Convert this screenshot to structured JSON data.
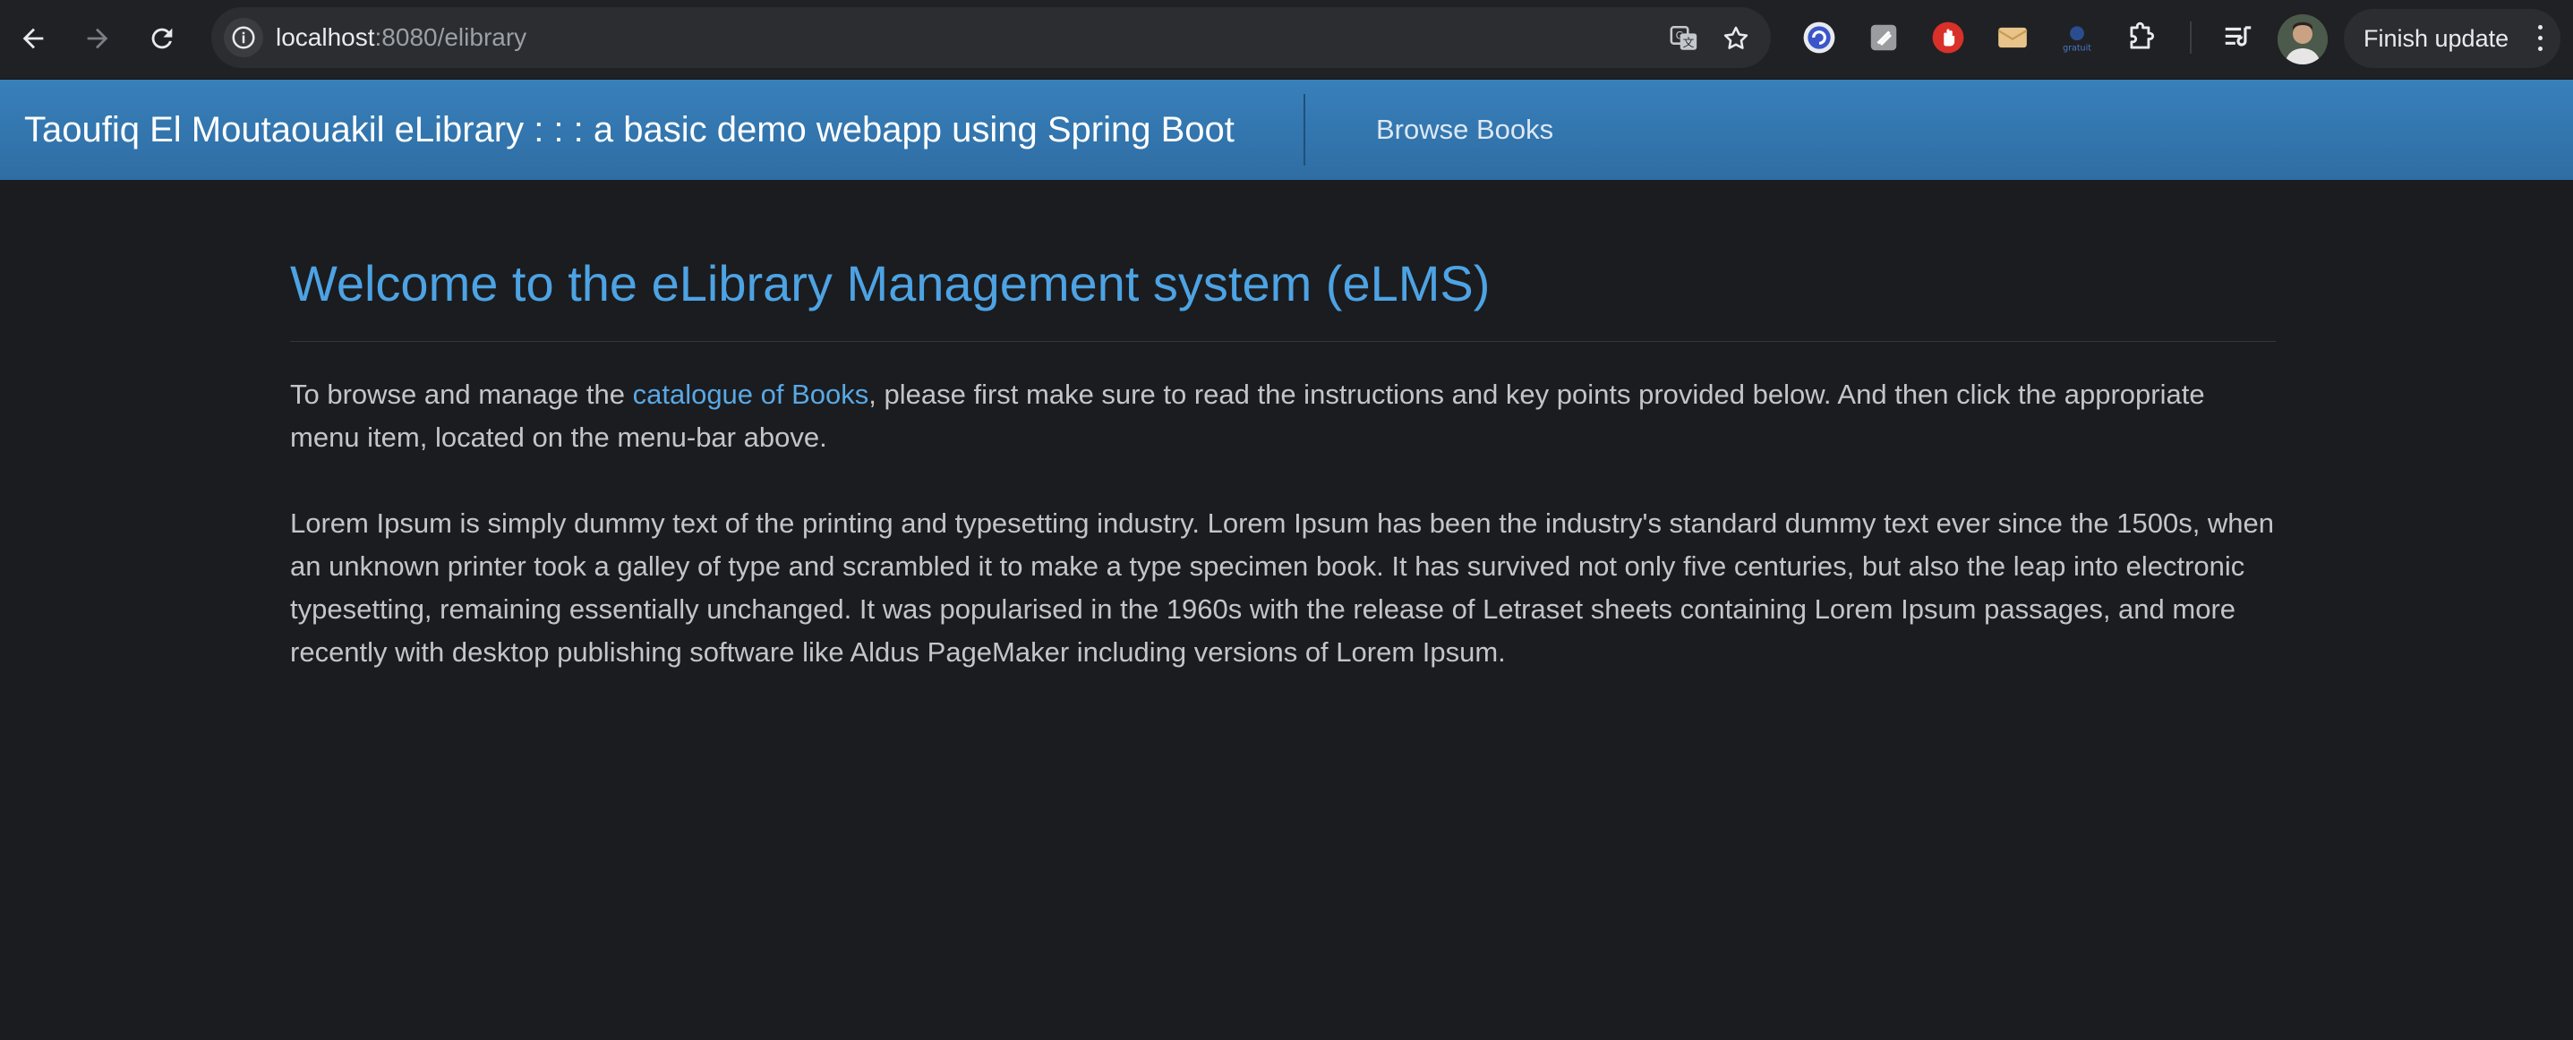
{
  "browser": {
    "url_host": "localhost",
    "url_path": ":8080/elibrary",
    "finish_update_label": "Finish update",
    "icons": [
      "back-arrow-icon",
      "forward-arrow-icon",
      "reload-icon",
      "site-info-icon",
      "translate-icon",
      "bookmark-star-icon",
      "extensions-puzzle-icon",
      "reading-list-icon",
      "more-vert-icon"
    ]
  },
  "navbar": {
    "brand": "Taoufiq El Moutaouakil eLibrary : : : a basic demo webapp using Spring Boot",
    "browse_books": "Browse Books"
  },
  "main": {
    "title": "Welcome to the eLibrary Management system (eLMS)",
    "intro_before_link": "To browse and manage the ",
    "intro_link": "catalogue of Books",
    "intro_after_link": ", please first make sure to read the instructions and key points provided below. And then click the appropriate menu item, located on the menu-bar above.",
    "lorem": "Lorem Ipsum is simply dummy text of the printing and typesetting industry. Lorem Ipsum has been the industry's standard dummy text ever since the 1500s, when an unknown printer took a galley of type and scrambled it to make a type specimen book. It has survived not only five centuries, but also the leap into electronic typesetting, remaining essentially unchanged. It was popularised in the 1960s with the release of Letraset sheets containing Lorem Ipsum passages, and more recently with desktop publishing software like Aldus PageMaker including versions of Lorem Ipsum."
  },
  "colors": {
    "navbar": "#3479b2",
    "title": "#4da3e3",
    "link": "#59a8e6",
    "page_bg": "#1b1c1f"
  }
}
